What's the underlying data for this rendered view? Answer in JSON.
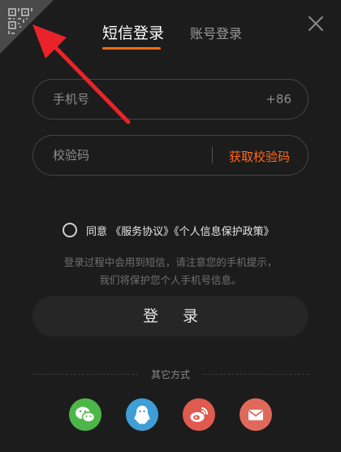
{
  "tabs": {
    "sms_login": "短信登录",
    "account_login": "账号登录"
  },
  "phone": {
    "placeholder": "手机号",
    "country_code": "+86"
  },
  "code": {
    "placeholder": "校验码",
    "get_code_label": "获取校验码"
  },
  "agreement": {
    "prefix": "同意",
    "service_link": "《服务协议》",
    "privacy_link": "《个人信息保护政策》"
  },
  "notice": {
    "line1": "登录过程中会用到短信，请注意您的手机提示，",
    "line2": "我们将保护您个人手机号信息。"
  },
  "login_button": "登 录",
  "other_methods": "其它方式",
  "social": [
    "wechat-icon",
    "qq-icon",
    "weibo-icon",
    "mail-icon"
  ],
  "colors": {
    "background": "#1c1c1c",
    "accent": "#ff6a1a",
    "wechat": "#4cb648",
    "qq": "#3f9ed6",
    "weibo": "#e05a4f",
    "mail": "#df6a5c",
    "annotation_arrow": "#e8242a"
  }
}
